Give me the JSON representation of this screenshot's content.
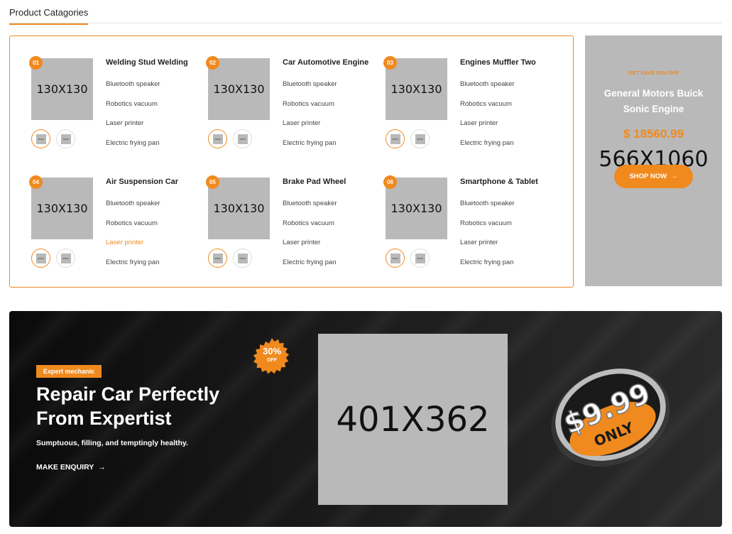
{
  "section": {
    "title": "Product Catagories"
  },
  "categories": [
    {
      "num": "01",
      "name": "Welding Stud Welding",
      "thumb": "130X130",
      "links": [
        "Bluetooth speaker",
        "Robotics vacuum",
        "Laser printer",
        "Electric frying pan"
      ]
    },
    {
      "num": "02",
      "name": "Car Automotive Engine",
      "thumb": "130X130",
      "links": [
        "Bluetooth speaker",
        "Robotics vacuum",
        "Laser printer",
        "Electric frying pan"
      ]
    },
    {
      "num": "03",
      "name": "Engines Muffler Two",
      "thumb": "130X130",
      "links": [
        "Bluetooth speaker",
        "Robotics vacuum",
        "Laser printer",
        "Electric frying pan"
      ]
    },
    {
      "num": "04",
      "name": "Air Suspension Car",
      "thumb": "130X130",
      "links": [
        "Bluetooth speaker",
        "Robotics vacuum",
        "Laser printer",
        "Electric frying pan"
      ]
    },
    {
      "num": "05",
      "name": "Brake Pad Wheel",
      "thumb": "130X130",
      "links": [
        "Bluetooth speaker",
        "Robotics vacuum",
        "Laser printer",
        "Electric frying pan"
      ]
    },
    {
      "num": "06",
      "name": "Smartphone & Tablet",
      "thumb": "130X130",
      "links": [
        "Bluetooth speaker",
        "Robotics vacuum",
        "Laser printer",
        "Electric frying pan"
      ]
    }
  ],
  "promo": {
    "kicker": "GET SAVE 30% OFF",
    "title": "General Motors Buick Sonic Engine",
    "price": "$ 18560.99",
    "image_size": "566X1060",
    "button": "SHOP NOW",
    "button_icon": "arrow-right-icon"
  },
  "banner": {
    "tag": "Expert mechanic",
    "heading_line1": "Repair Car Perfectly",
    "heading_line2": "From Expertist",
    "subtitle": "Sumptuous, filling, and temptingly healthy.",
    "link": "MAKE ENQUIRY",
    "link_icon": "arrow-right-icon",
    "seal_percent": "30%",
    "seal_off": "OFF",
    "image_size": "401X362",
    "price_badge": "$9.99",
    "price_badge_sub": "ONLY"
  },
  "colors": {
    "accent": "#f08a1e",
    "placeholder": "#b9b9b9",
    "banner_bg": "#141414"
  }
}
